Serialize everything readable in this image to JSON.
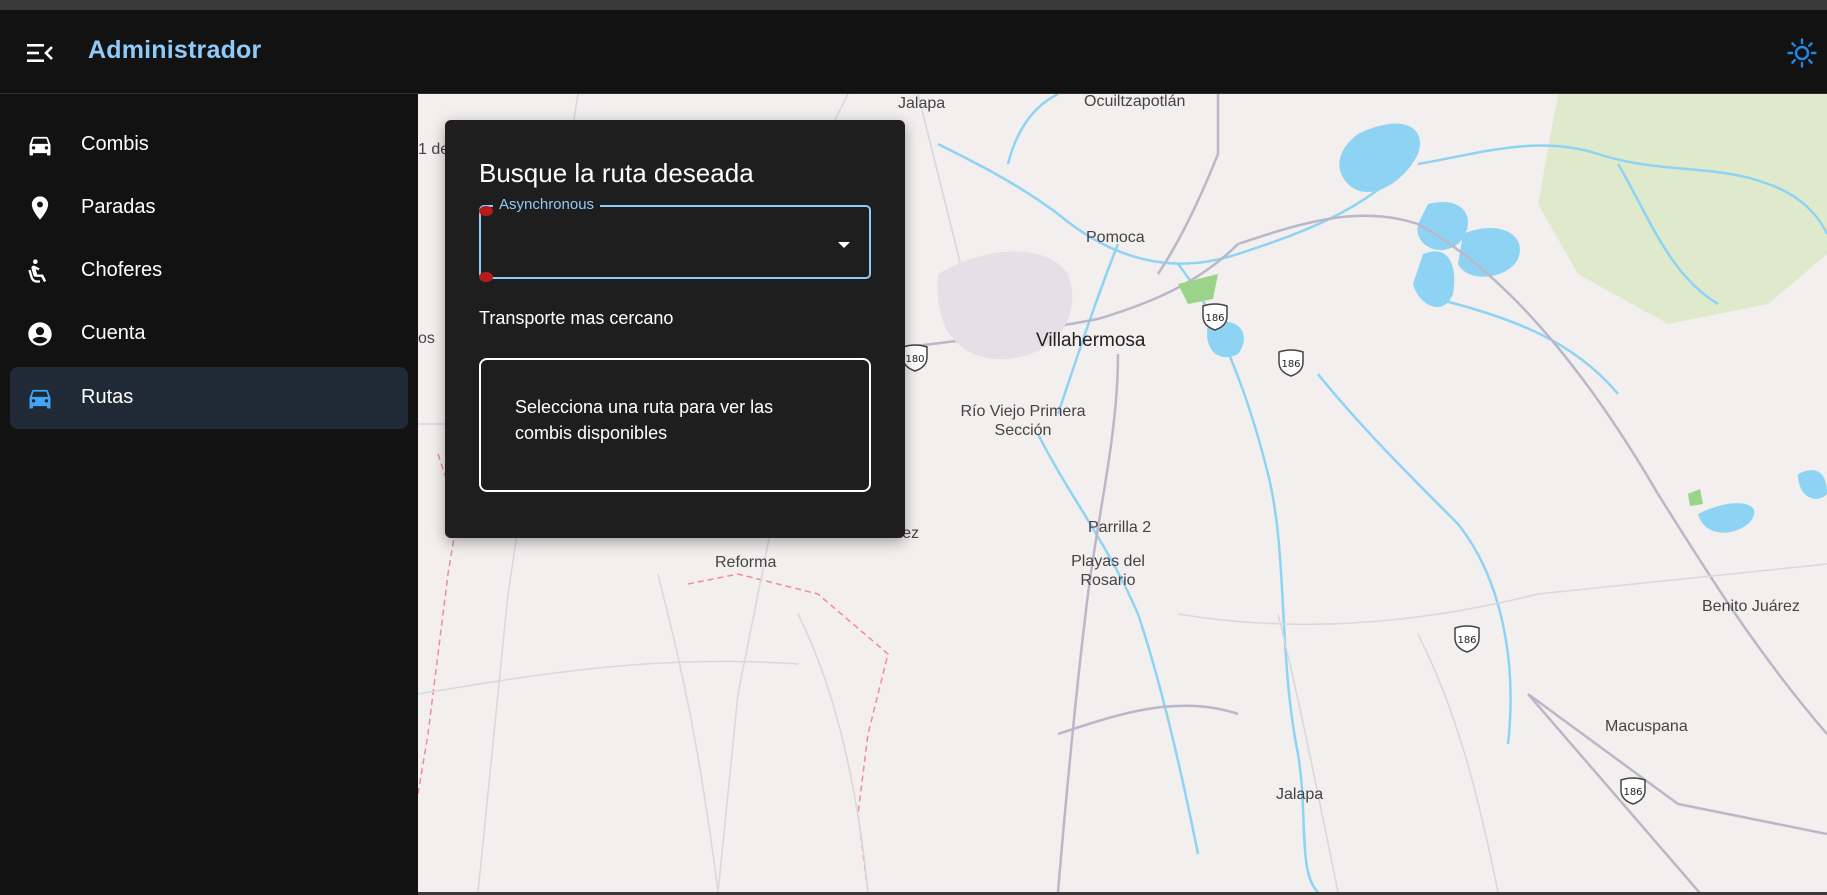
{
  "app": {
    "title": "Administrador",
    "menu_icon": "menu-open-icon",
    "theme_icon": "sun-icon",
    "accent": "#90caf9"
  },
  "sidebar": {
    "items": [
      {
        "label": "Combis",
        "icon": "car-icon",
        "active": false
      },
      {
        "label": "Paradas",
        "icon": "location-pin-icon",
        "active": false
      },
      {
        "label": "Choferes",
        "icon": "seated-person-icon",
        "active": false
      },
      {
        "label": "Cuenta",
        "icon": "account-circle-icon",
        "active": false
      },
      {
        "label": "Rutas",
        "icon": "car-icon",
        "active": true
      }
    ]
  },
  "panel": {
    "title": "Busque la ruta deseada",
    "select_label": "Asynchronous",
    "select_value": "",
    "nearest_heading": "Transporte mas cercano",
    "info_message": "Selecciona una ruta para ver las combis disponibles"
  },
  "map": {
    "labels": [
      "Jalapa",
      "Ocuiltzapotlán",
      "1 de",
      "os",
      "Pomoca",
      "Villahermosa",
      "Río Viejo Primera Sección",
      "Parrilla 2",
      "Playas del Rosario",
      "Reforma",
      "érez",
      "Benito Juárez",
      "Macuspana",
      "Jalapa"
    ],
    "highway_shields": [
      "186",
      "186",
      "180",
      "186",
      "186"
    ]
  }
}
